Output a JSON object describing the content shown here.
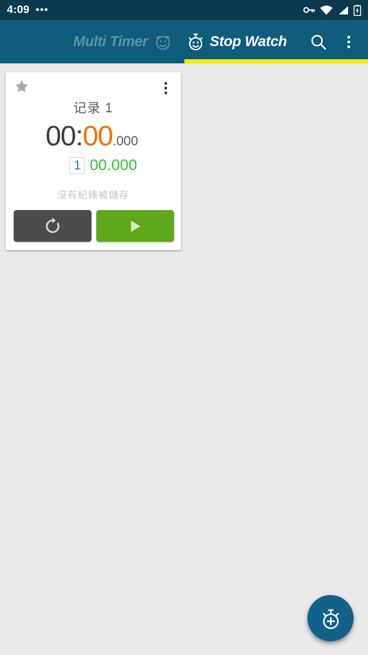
{
  "status_bar": {
    "time": "4:09",
    "notification_dots": "•••",
    "icons": [
      "vpn-key-icon",
      "wifi-icon",
      "cellular-signal-icon",
      "battery-icon"
    ],
    "background_color": "#0a3a4d"
  },
  "app_bar": {
    "background_color": "#0f5c7d",
    "indicator_color": "#f2ea00",
    "tabs": [
      {
        "label": "Multi Timer",
        "icon": "alarm-clock-icon",
        "active": false
      },
      {
        "label": "Stop Watch",
        "icon": "stopwatch-icon",
        "active": true
      }
    ],
    "actions": [
      {
        "name": "search-icon",
        "label": "Search"
      },
      {
        "name": "overflow-menu-icon",
        "label": "More options"
      }
    ]
  },
  "card": {
    "star_icon": "star-icon",
    "overflow_icon": "overflow-menu-icon",
    "title": "记录 1",
    "time": {
      "main": "00:",
      "seconds": "00",
      "millis": ".000",
      "main_color": "#3c3c3c",
      "seconds_color": "#f57000",
      "millis_color": "#5a5a5a"
    },
    "lap": {
      "number": "1",
      "time": "00.000",
      "number_color": "#2277bb",
      "time_color": "#2dc42d"
    },
    "empty_message": "沒有紀錄被儲存",
    "buttons": [
      {
        "name": "reset-button",
        "icon": "refresh-icon",
        "color": "#4b4b4b"
      },
      {
        "name": "start-button",
        "icon": "play-icon",
        "color": "#5fa81b"
      }
    ]
  },
  "fab": {
    "name": "add-stopwatch-fab",
    "icon": "stopwatch-plus-icon",
    "color": "#11618a"
  }
}
